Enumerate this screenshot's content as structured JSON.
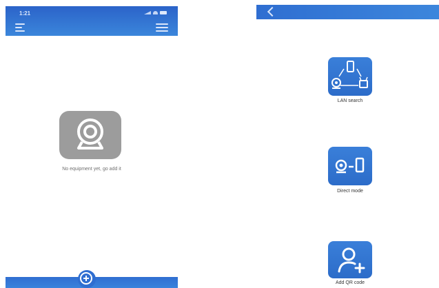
{
  "left_screen": {
    "status_time": "1:21",
    "empty_message": "No equipment yet, go add it"
  },
  "right_screen": {
    "options": [
      {
        "label": "LAN search"
      },
      {
        "label": "Direct mode"
      },
      {
        "label": "Add QR code"
      }
    ]
  },
  "colors": {
    "header_blue": "#2f6ed1",
    "tile_gray": "#9c9c9c",
    "option_blue": "#3478d4"
  },
  "icons": {
    "left_menu": "hamburger-icon",
    "right_menu": "list-icon",
    "add": "plus-circle-icon",
    "back": "chevron-left-icon",
    "lan": "lan-search-icon",
    "direct": "camera-to-phone-icon",
    "qr": "add-user-icon",
    "empty": "camera-icon"
  }
}
